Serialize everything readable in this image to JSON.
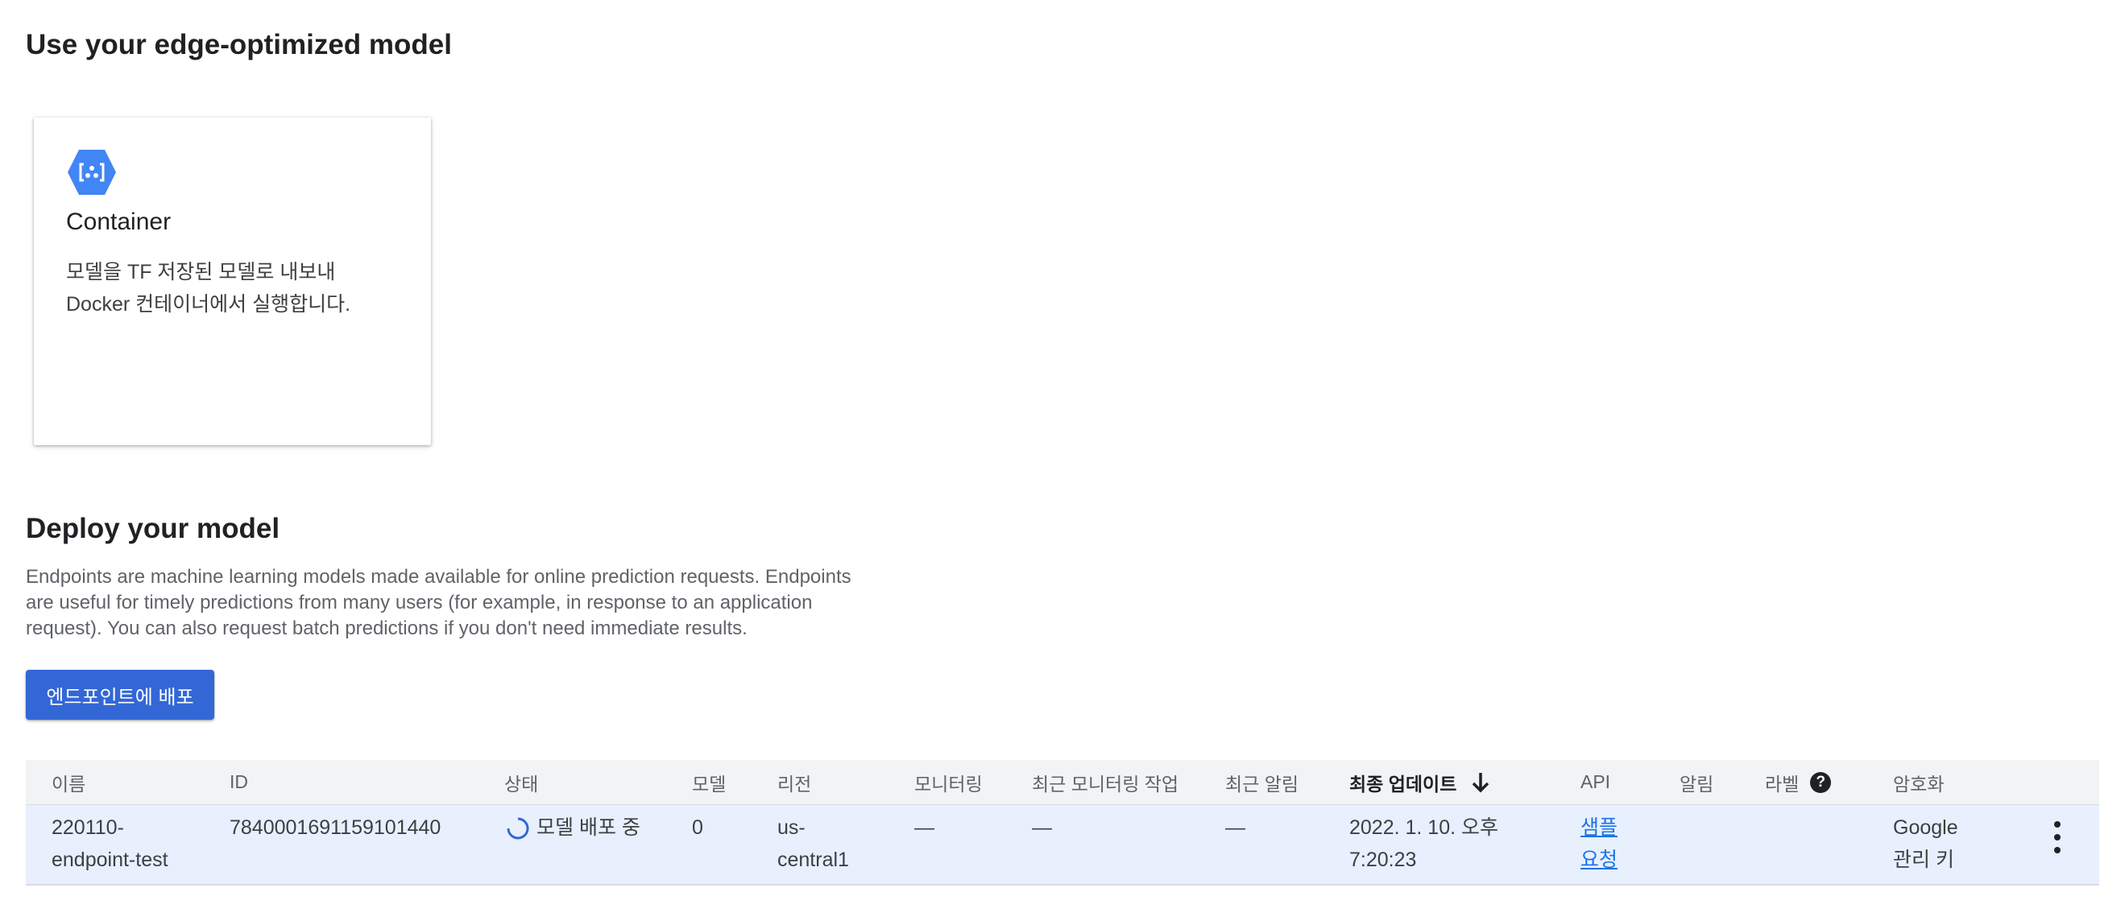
{
  "edge_section": {
    "title": "Use your edge-optimized model",
    "card": {
      "title": "Container",
      "desc_line1": "모델을 TF 저장된 모델로 내보내",
      "desc_line2": "Docker 컨테이너에서 실행합니다.",
      "icon": "container-hex-icon",
      "icon_color": "#4285f4"
    }
  },
  "deploy_section": {
    "title": "Deploy your model",
    "description": "Endpoints are machine learning models made available for online prediction requests. Endpoints are useful for timely predictions from many users (for example, in response to an application request). You can also request batch predictions if you don't need immediate results.",
    "button_label": "엔드포인트에 배포",
    "button_color": "#3367d6"
  },
  "table": {
    "headers": {
      "name": "이름",
      "id": "ID",
      "status": "상태",
      "model": "모델",
      "region": "리전",
      "monitoring": "모니터링",
      "recent_job": "최근 모니터링 작업",
      "recent_alert": "최근 알림",
      "last_updated": "최종 업데이트",
      "api": "API",
      "alerts": "알림",
      "labels": "라벨",
      "encryption": "암호화"
    },
    "sort": {
      "column": "last_updated",
      "direction": "descending"
    },
    "rows": [
      {
        "name_line1": "220110-",
        "name_line2": "endpoint-test",
        "id": "7840001691159101440",
        "status": "모델 배포 중",
        "model": "0",
        "region_line1": "us-",
        "region_line2": "central1",
        "monitoring": "—",
        "recent_job": "—",
        "recent_alert": "—",
        "updated_line1": "2022. 1. 10. 오후",
        "updated_line2": "7:20:23",
        "api_line1": "샘플",
        "api_line2": "요청",
        "encryption_line1": "Google",
        "encryption_line2": "관리 키"
      }
    ]
  },
  "colors": {
    "link": "#1a73e8",
    "row_selected": "#e8f0fe",
    "header_bg": "#f1f3f4"
  }
}
